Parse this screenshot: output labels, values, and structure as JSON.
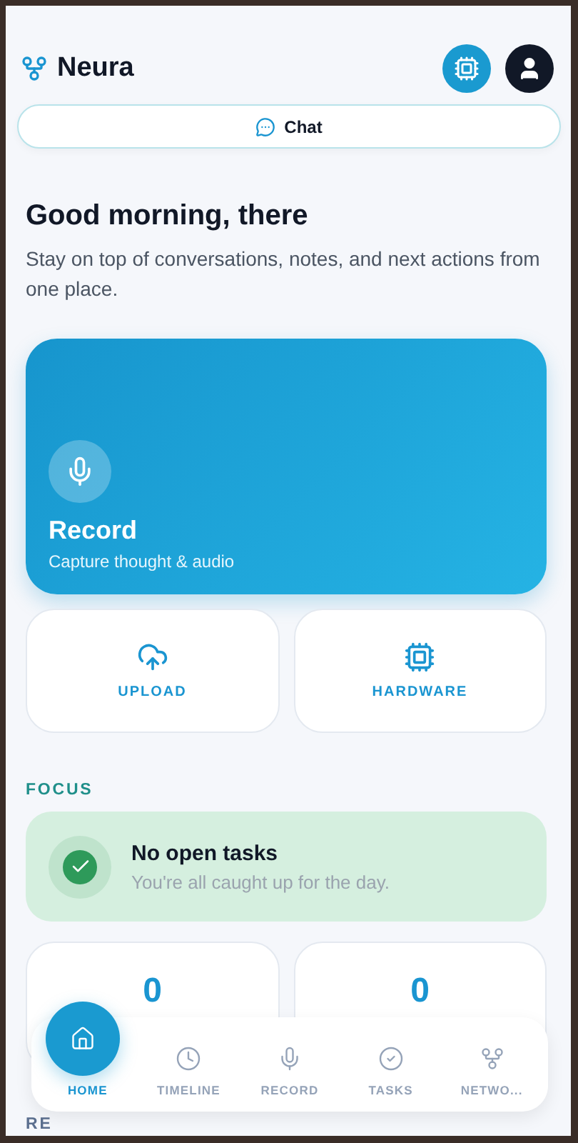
{
  "header": {
    "title": "Neura"
  },
  "chat_button": {
    "label": "Chat"
  },
  "greeting": {
    "title": "Good morning, there",
    "subtitle": "Stay on top of conversations, notes, and next actions from one place."
  },
  "record_card": {
    "title": "Record",
    "subtitle": "Capture thought & audio"
  },
  "actions": [
    {
      "kind": "upload",
      "label": "UPLOAD"
    },
    {
      "kind": "hardware",
      "label": "HARDWARE"
    }
  ],
  "focus": {
    "heading": "FOCUS",
    "title": "No open tasks",
    "subtitle": "You're all caught up for the day."
  },
  "stats": [
    {
      "value": "0"
    },
    {
      "value": "0"
    }
  ],
  "next_section": {
    "heading": "RE"
  },
  "nav": [
    {
      "kind": "home",
      "label": "HOME",
      "selected": true
    },
    {
      "kind": "timeline",
      "label": "TIMELINE",
      "selected": false
    },
    {
      "kind": "record",
      "label": "RECORD",
      "selected": false
    },
    {
      "kind": "tasks",
      "label": "TASKS",
      "selected": false
    },
    {
      "kind": "network",
      "label": "NETWO..."
    }
  ]
}
